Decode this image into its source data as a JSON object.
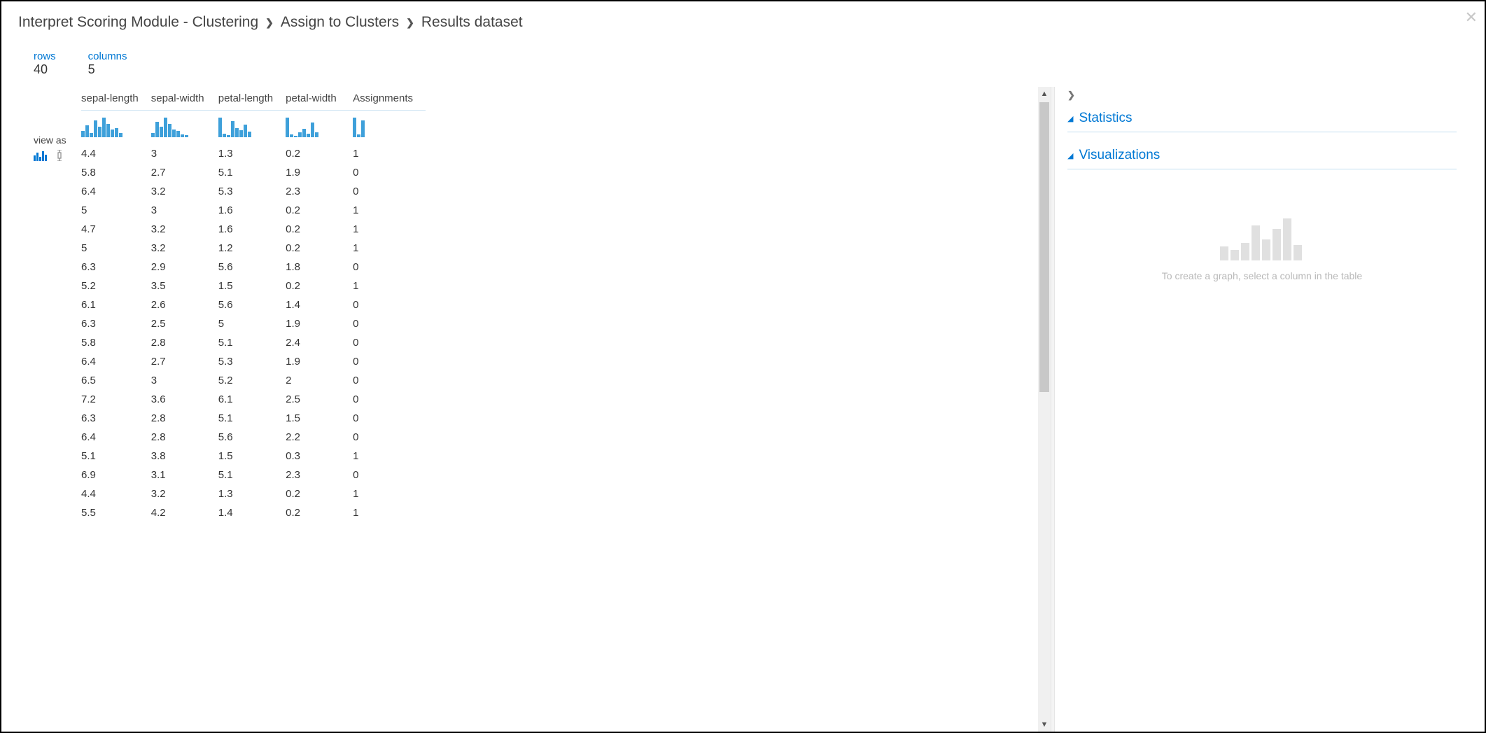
{
  "breadcrumb": [
    "Interpret Scoring Module - Clustering",
    "Assign to Clusters",
    "Results dataset"
  ],
  "meta": {
    "rows_label": "rows",
    "rows_value": "40",
    "cols_label": "columns",
    "cols_value": "5"
  },
  "view_as_label": "view as",
  "columns": [
    "sepal-length",
    "sepal-width",
    "petal-length",
    "petal-width",
    "Assignments"
  ],
  "histograms": [
    [
      8,
      16,
      6,
      22,
      14,
      26,
      18,
      10,
      12,
      6
    ],
    [
      6,
      20,
      14,
      26,
      18,
      10,
      8,
      4,
      3
    ],
    [
      22,
      4,
      2,
      18,
      10,
      8,
      14,
      6
    ],
    [
      24,
      3,
      2,
      6,
      10,
      4,
      18,
      6
    ],
    [
      28,
      4,
      24
    ]
  ],
  "rows": [
    [
      "4.4",
      "3",
      "1.3",
      "0.2",
      "1"
    ],
    [
      "5.8",
      "2.7",
      "5.1",
      "1.9",
      "0"
    ],
    [
      "6.4",
      "3.2",
      "5.3",
      "2.3",
      "0"
    ],
    [
      "5",
      "3",
      "1.6",
      "0.2",
      "1"
    ],
    [
      "4.7",
      "3.2",
      "1.6",
      "0.2",
      "1"
    ],
    [
      "5",
      "3.2",
      "1.2",
      "0.2",
      "1"
    ],
    [
      "6.3",
      "2.9",
      "5.6",
      "1.8",
      "0"
    ],
    [
      "5.2",
      "3.5",
      "1.5",
      "0.2",
      "1"
    ],
    [
      "6.1",
      "2.6",
      "5.6",
      "1.4",
      "0"
    ],
    [
      "6.3",
      "2.5",
      "5",
      "1.9",
      "0"
    ],
    [
      "5.8",
      "2.8",
      "5.1",
      "2.4",
      "0"
    ],
    [
      "6.4",
      "2.7",
      "5.3",
      "1.9",
      "0"
    ],
    [
      "6.5",
      "3",
      "5.2",
      "2",
      "0"
    ],
    [
      "7.2",
      "3.6",
      "6.1",
      "2.5",
      "0"
    ],
    [
      "6.3",
      "2.8",
      "5.1",
      "1.5",
      "0"
    ],
    [
      "6.4",
      "2.8",
      "5.6",
      "2.2",
      "0"
    ],
    [
      "5.1",
      "3.8",
      "1.5",
      "0.3",
      "1"
    ],
    [
      "6.9",
      "3.1",
      "5.1",
      "2.3",
      "0"
    ],
    [
      "4.4",
      "3.2",
      "1.3",
      "0.2",
      "1"
    ],
    [
      "5.5",
      "4.2",
      "1.4",
      "0.2",
      "1"
    ]
  ],
  "right": {
    "crumb": "❯",
    "statistics_label": "Statistics",
    "visualizations_label": "Visualizations",
    "placeholder_text": "To create a graph, select a column in the table"
  },
  "chart_data": {
    "type": "table",
    "columns": [
      "sepal-length",
      "sepal-width",
      "petal-length",
      "petal-width",
      "Assignments"
    ],
    "rows": [
      [
        4.4,
        3,
        1.3,
        0.2,
        1
      ],
      [
        5.8,
        2.7,
        5.1,
        1.9,
        0
      ],
      [
        6.4,
        3.2,
        5.3,
        2.3,
        0
      ],
      [
        5,
        3,
        1.6,
        0.2,
        1
      ],
      [
        4.7,
        3.2,
        1.6,
        0.2,
        1
      ],
      [
        5,
        3.2,
        1.2,
        0.2,
        1
      ],
      [
        6.3,
        2.9,
        5.6,
        1.8,
        0
      ],
      [
        5.2,
        3.5,
        1.5,
        0.2,
        1
      ],
      [
        6.1,
        2.6,
        5.6,
        1.4,
        0
      ],
      [
        6.3,
        2.5,
        5,
        1.9,
        0
      ],
      [
        5.8,
        2.8,
        5.1,
        2.4,
        0
      ],
      [
        6.4,
        2.7,
        5.3,
        1.9,
        0
      ],
      [
        6.5,
        3,
        5.2,
        2,
        0
      ],
      [
        7.2,
        3.6,
        6.1,
        2.5,
        0
      ],
      [
        6.3,
        2.8,
        5.1,
        1.5,
        0
      ],
      [
        6.4,
        2.8,
        5.6,
        2.2,
        0
      ],
      [
        5.1,
        3.8,
        1.5,
        0.3,
        1
      ],
      [
        6.9,
        3.1,
        5.1,
        2.3,
        0
      ],
      [
        4.4,
        3.2,
        1.3,
        0.2,
        1
      ],
      [
        5.5,
        4.2,
        1.4,
        0.2,
        1
      ]
    ],
    "total_rows": 40,
    "total_columns": 5
  }
}
